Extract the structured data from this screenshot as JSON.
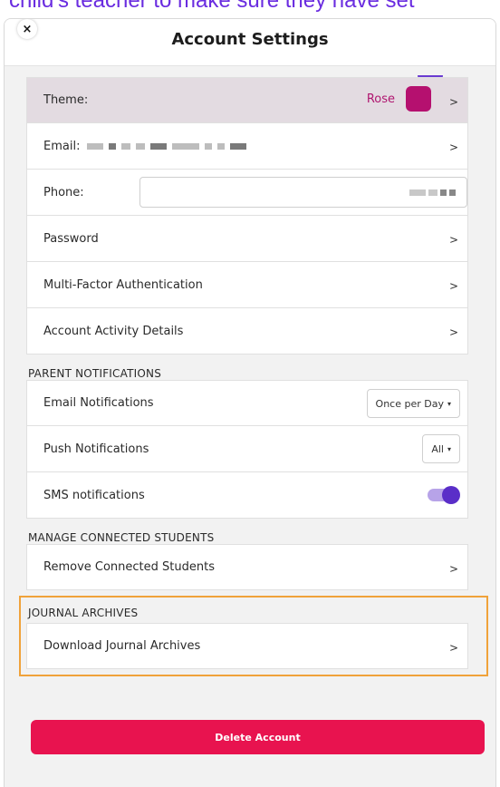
{
  "banner": {
    "text": "child's teacher to make sure they have set"
  },
  "header": {
    "title": "Account Settings",
    "close_label": "×"
  },
  "account": {
    "theme_label": "Theme:",
    "theme_value": "Rose",
    "theme_color": "#b5106f",
    "email_label": "Email:",
    "phone_label": "Phone:",
    "password_label": "Password",
    "mfa_label": "Multi-Factor Authentication",
    "activity_label": "Account Activity Details"
  },
  "parent_notifications": {
    "title": "PARENT NOTIFICATIONS",
    "email_label": "Email Notifications",
    "email_value": "Once per Day",
    "push_label": "Push Notifications",
    "push_value": "All",
    "sms_label": "SMS notifications",
    "sms_enabled": true
  },
  "connected_students": {
    "title": "MANAGE CONNECTED STUDENTS",
    "remove_label": "Remove Connected Students"
  },
  "journal_archives": {
    "title": "JOURNAL ARCHIVES",
    "download_label": "Download Journal Archives"
  },
  "chevron": ">",
  "caret": "▾",
  "delete_label": "Delete Account",
  "colors": {
    "accent": "#5a2ec8",
    "danger": "#e8134f",
    "highlight": "#f0a23a"
  }
}
